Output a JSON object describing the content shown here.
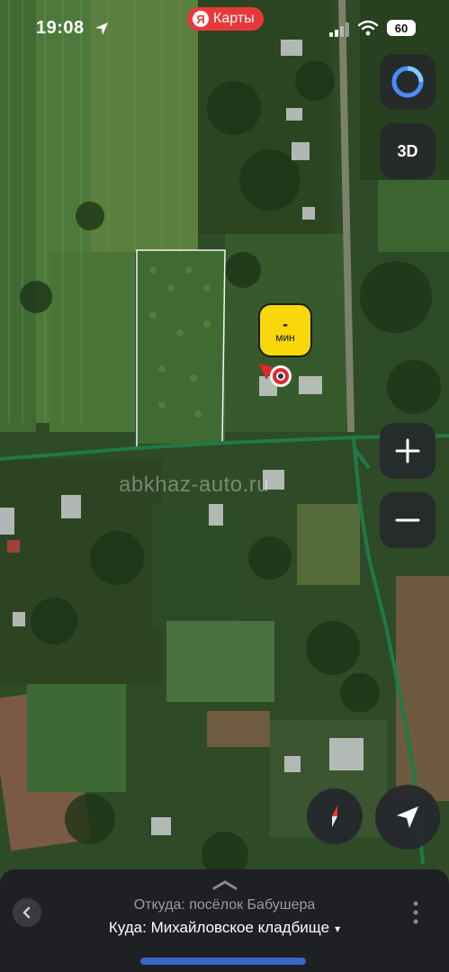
{
  "status_bar": {
    "time": "19:08",
    "app_pill_label": "Карты",
    "app_pill_logo": "Я",
    "battery": "60"
  },
  "map": {
    "controls": {
      "threed_label": "3D",
      "zoom_in_label": "+",
      "zoom_out_label": "−"
    },
    "route_label": {
      "value": "-",
      "unit": "мин"
    },
    "watermark": "abkhaz-auto.ru",
    "colors": {
      "route_line": "#1f7a48",
      "eta_badge": "#f8d80a",
      "pin": "#e0262e"
    }
  },
  "route_sheet": {
    "from_text": "Откуда: посёлок Бабушера",
    "to_text": "Куда: Михайловское кладбище",
    "to_caret": "▾"
  }
}
